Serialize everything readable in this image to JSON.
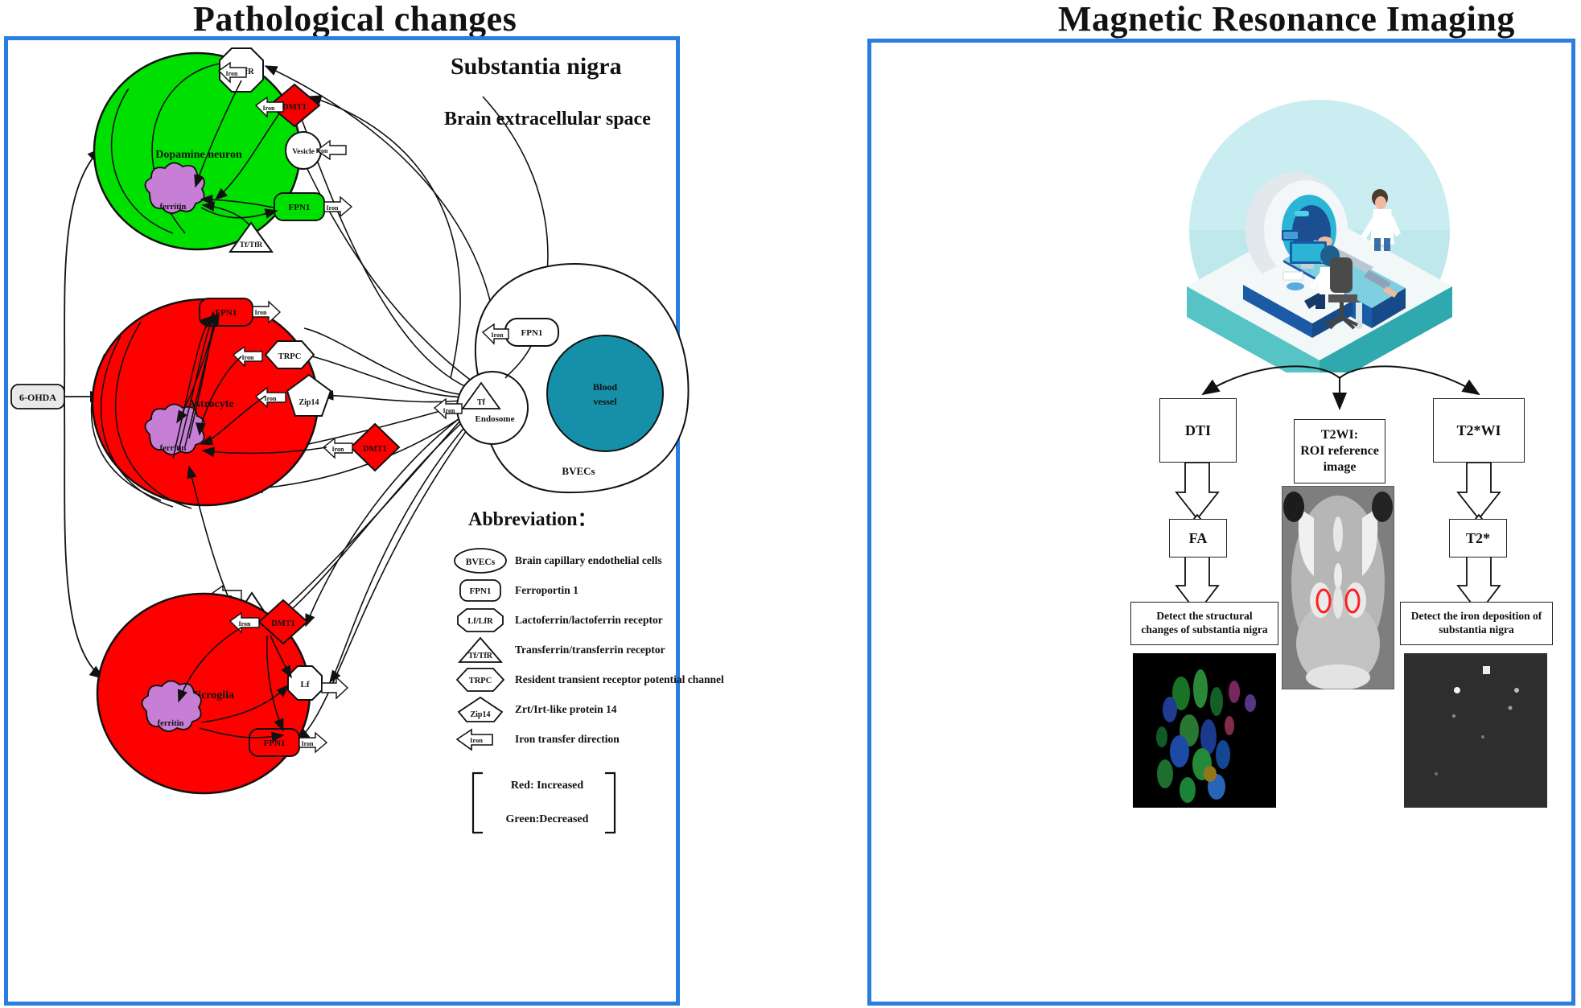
{
  "titles": {
    "left": "Pathological changes",
    "right": "Magnetic Resonance Imaging"
  },
  "left_panel": {
    "section_title": "Substantia nigra",
    "subsection_title": "Brain extracellular space",
    "stimulus": "6-OHDA",
    "cells": [
      {
        "name": "Dopamine neuron",
        "color": "#00e000",
        "state": "decreased",
        "organelle": "ferritin",
        "organelle_color": "#c77fd6"
      },
      {
        "name": "Astrocyte",
        "color": "#fe0000",
        "state": "increased",
        "organelle": "ferritin",
        "organelle_color": "#c77fd6"
      },
      {
        "name": "Microglia",
        "color": "#fe0000",
        "state": "increased",
        "organelle": "ferritin",
        "organelle_color": "#c77fd6"
      }
    ],
    "neuron_nodes": [
      "Lf/LfR",
      "DMT1",
      "Vesicle",
      "ferritin",
      "FPN1",
      "Tf/TfR"
    ],
    "astrocyte_nodes": [
      "FPN1",
      "TRPC",
      "Zip14",
      "DMT1",
      "ferritin",
      "Tf/TfR"
    ],
    "microglia_nodes": [
      "DMT1",
      "Lf",
      "ferritin",
      "FPN1"
    ],
    "bvec_nodes": [
      "FPN1",
      "Tf",
      "Endosome",
      "Blood vessel",
      "BVECs"
    ],
    "vessel_label": "Blood\nvessel",
    "vessel_label_l1": "Blood",
    "vessel_label_l2": "vessel",
    "endosome_label": "Endosome",
    "bvecs_label": "BVECs",
    "iron_label": "Iron",
    "abbreviation": {
      "heading": "Abbreviation：",
      "items": [
        {
          "shape": "ellipse",
          "code": "BVECs",
          "meaning": "Brain capillary endothelial cells"
        },
        {
          "shape": "rounded",
          "code": "FPN1",
          "meaning": "Ferroportin 1"
        },
        {
          "shape": "octagon",
          "code": "Lf/LfR",
          "meaning": "Lactoferrin/lactoferrin receptor"
        },
        {
          "shape": "triangle",
          "code": "Tf/TfR",
          "meaning": "Transferrin/transferrin receptor"
        },
        {
          "shape": "hexagon",
          "code": "TRPC",
          "meaning": "Resident transient receptor potential channel"
        },
        {
          "shape": "pentagon",
          "code": "Zip14",
          "meaning": "Zrt/Irt-like protein 14"
        },
        {
          "shape": "arrow",
          "code": "Iron",
          "meaning": "Iron transfer direction"
        }
      ],
      "legend": [
        "Red: Increased",
        "Green:Decreased"
      ]
    }
  },
  "right_panel": {
    "illustration_name": "mri-scanner-scene",
    "flow": {
      "sequences": [
        {
          "id": "dti",
          "label": "DTI"
        },
        {
          "id": "t2wi",
          "label": "T2WI:\nROI reference\nimage",
          "line1": "T2WI:",
          "line2": "ROI reference",
          "line3": "image"
        },
        {
          "id": "t2swi",
          "label": "T2*WI"
        }
      ],
      "metrics": [
        {
          "id": "fa",
          "label": "FA"
        },
        {
          "id": "t2s",
          "label": "T2*"
        }
      ],
      "conclusions": [
        {
          "id": "structural",
          "line1": "Detect the structural",
          "line2": "changes of substantia nigra"
        },
        {
          "id": "iron",
          "line1": "Detect the iron deposition of",
          "line2": "substantia nigra"
        }
      ]
    },
    "images": [
      {
        "id": "t2wi-roi-image",
        "caption": ""
      },
      {
        "id": "dti-color-fa-map",
        "caption": ""
      },
      {
        "id": "t2star-map",
        "caption": ""
      }
    ]
  },
  "center": {
    "subject_icon": "mouse-icon",
    "left_arrow": "double-arrow-left-icon",
    "right_arrow": "double-arrow-right-icon"
  },
  "colors": {
    "panel_border": "#2a7de1",
    "increased": "#fe0000",
    "decreased": "#00e000",
    "ferritin": "#c77fd6",
    "vessel": "#1590a8",
    "roi_marker": "#ff1f1f"
  }
}
